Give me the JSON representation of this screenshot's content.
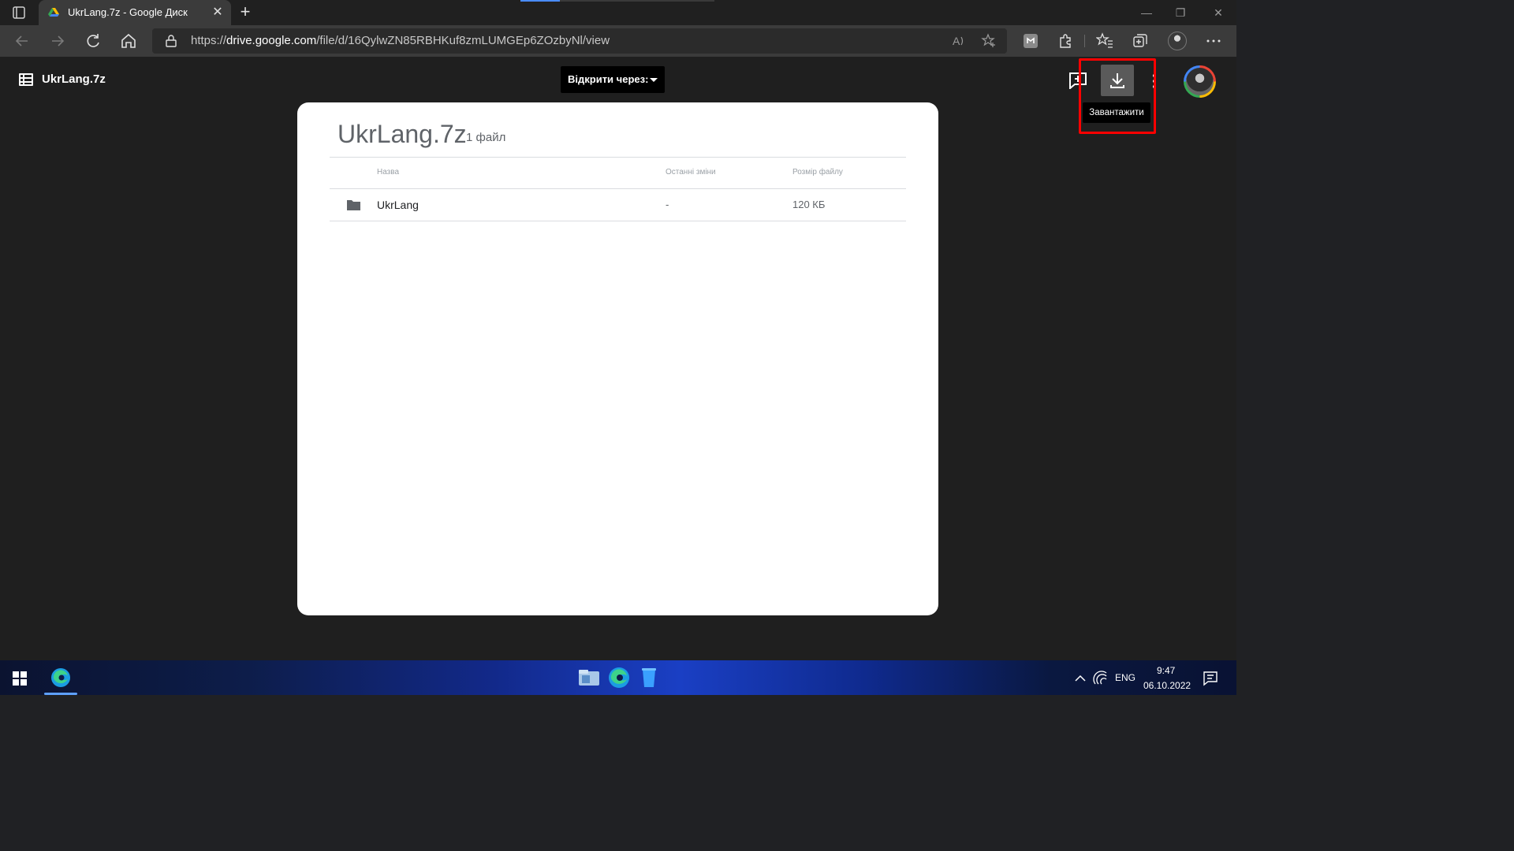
{
  "browser": {
    "tab_title": "UkrLang.7z - Google Диск",
    "url_prefix": "https://",
    "url_host": "drive.google.com",
    "url_path": "/file/d/16QylwZN85RBHKuf8zmLUMGEp6ZOzbyNl/view"
  },
  "viewer": {
    "title": "UkrLang.7z",
    "open_with_label": "Відкрити через:",
    "download_tooltip": "Завантажити"
  },
  "archive": {
    "title": "UkrLang.7z",
    "file_count": "1 файл",
    "columns": {
      "name": "Назва",
      "modified": "Останні зміни",
      "size": "Розмір файлу"
    },
    "rows": [
      {
        "name": "UkrLang",
        "modified": "-",
        "size": "120 КБ"
      }
    ]
  },
  "taskbar": {
    "language": "ENG",
    "time": "9:47",
    "date": "06.10.2022"
  },
  "colors": {
    "highlight": "#ff0000",
    "viewer_bg": "#1f1f1f",
    "accent": "#4285f4"
  }
}
